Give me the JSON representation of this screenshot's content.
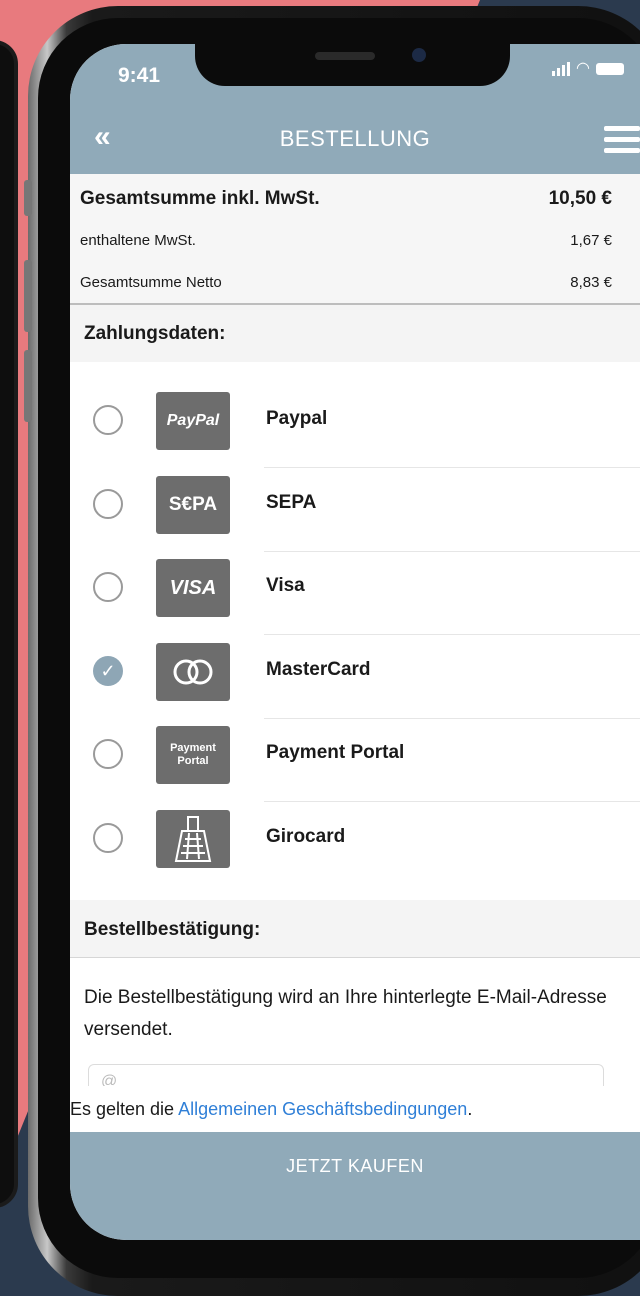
{
  "status_bar": {
    "time": "9:41"
  },
  "nav": {
    "back_icon": "«",
    "title": "BESTELLUNG",
    "menu_icon": "hamburger-menu-icon"
  },
  "summary": {
    "total_label": "Gesamtsumme inkl. MwSt.",
    "total_value": "10,50 €",
    "vat_label": "enthaltene MwSt.",
    "vat_value": "1,67 €",
    "net_label": "Gesamtsumme Netto",
    "net_value": "8,83 €"
  },
  "payment": {
    "heading": "Zahlungsdaten:",
    "items": [
      {
        "label": "Paypal",
        "logo_text": "PayPal",
        "selected": false
      },
      {
        "label": "SEPA",
        "logo_text": "S€PA",
        "selected": false
      },
      {
        "label": "Visa",
        "logo_text": "VISA",
        "selected": false
      },
      {
        "label": "MasterCard",
        "logo_text": "",
        "selected": true
      },
      {
        "label": "Payment Portal",
        "logo_text": "Payment Portal",
        "selected": false
      },
      {
        "label": "Girocard",
        "logo_text": "",
        "selected": false
      }
    ]
  },
  "confirmation": {
    "heading": "Bestellbestätigung:",
    "text": "Die Bestellbestätigung wird an Ihre hinterlegte E-Mail-Adresse versendet.",
    "email_placeholder": "@"
  },
  "terms": {
    "prefix": "Es gelten die ",
    "link": "Allgemeinen Geschäftsbedingungen",
    "suffix": "."
  },
  "buy_button": {
    "label": "JETZT KAUFEN"
  },
  "colors": {
    "accent": "#90aab9",
    "link": "#2f7fd7",
    "logo_bg": "#6d6d6d"
  }
}
